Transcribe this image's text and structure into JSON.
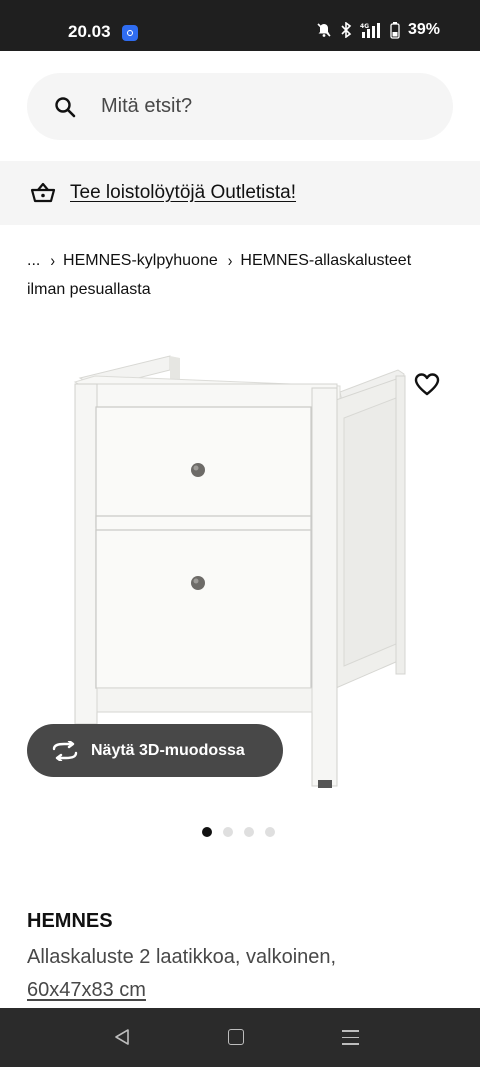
{
  "status_bar": {
    "time": "20.03",
    "battery": "39%",
    "network": "4G"
  },
  "search": {
    "placeholder": "Mitä etsit?",
    "icon": "search-icon"
  },
  "outlet": {
    "link_text": "Tee loistolöytöjä Outletista!",
    "icon": "basket-icon"
  },
  "breadcrumb": {
    "ellipsis": "...",
    "items": [
      "HEMNES-kylpyhuone",
      "HEMNES-allaskalusteet ilman pesuallasta"
    ]
  },
  "product": {
    "view3d_label": "Näytä 3D-muodossa",
    "image_count": 4,
    "active_image": 1,
    "name": "HEMNES",
    "description": "Allaskaluste 2 laatikkoa, valkoinen,",
    "size": "60x47x83 cm"
  },
  "colors": {
    "status_bar": "#1f1f1f",
    "pill_button": "#484848",
    "light_bg": "#f5f5f5",
    "nav_bar": "#2b2b2b"
  }
}
